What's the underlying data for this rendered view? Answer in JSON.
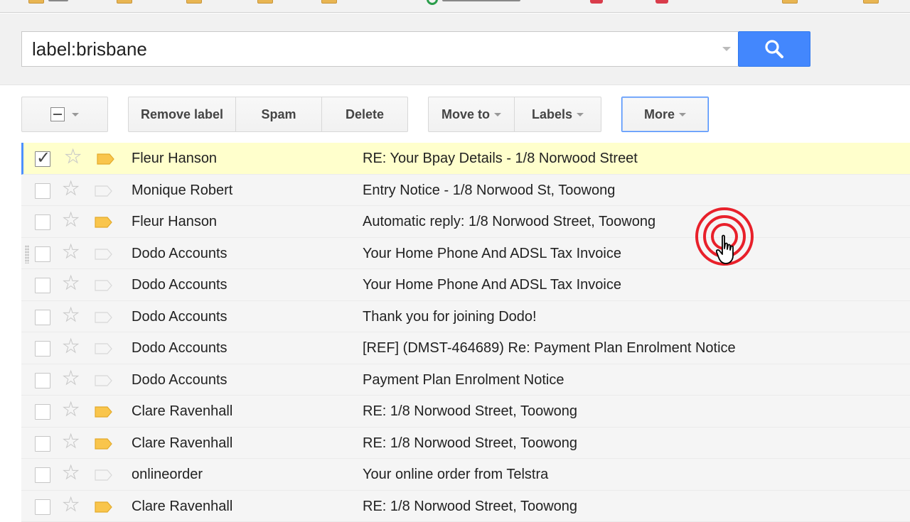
{
  "search": {
    "value": "label:brisbane",
    "button_icon": "search-icon"
  },
  "toolbar": {
    "select_icon": "select-checkbox-icon",
    "remove_label": "Remove label",
    "spam": "Spam",
    "delete": "Delete",
    "move_to": "Move to",
    "labels": "Labels",
    "more": "More"
  },
  "colors": {
    "search_button": "#4387fd",
    "selected_row": "#ffffcc",
    "label_marker": "#f9c54c",
    "ripple": "#e8202a"
  },
  "messages": [
    {
      "sender": "Fleur Hanson",
      "subject": "RE: Your Bpay Details - 1/8 Norwood Street",
      "checked": true,
      "labeled": true,
      "selected": true
    },
    {
      "sender": "Monique Robert",
      "subject": "Entry Notice - 1/8 Norwood St, Toowong",
      "checked": false,
      "labeled": false
    },
    {
      "sender": "Fleur Hanson",
      "subject": "Automatic reply: 1/8 Norwood Street, Toowong",
      "checked": false,
      "labeled": true
    },
    {
      "sender": "Dodo Accounts",
      "subject": "Your Home Phone And ADSL Tax Invoice",
      "checked": false,
      "labeled": false,
      "drag": true
    },
    {
      "sender": "Dodo Accounts",
      "subject": "Your Home Phone And ADSL Tax Invoice",
      "checked": false,
      "labeled": false
    },
    {
      "sender": "Dodo Accounts",
      "subject": "Thank you for joining Dodo!",
      "checked": false,
      "labeled": false
    },
    {
      "sender": "Dodo Accounts",
      "subject": "[REF] (DMST-464689) Re: Payment Plan Enrolment Notice",
      "checked": false,
      "labeled": false
    },
    {
      "sender": "Dodo Accounts",
      "subject": "Payment Plan Enrolment Notice",
      "checked": false,
      "labeled": false
    },
    {
      "sender": "Clare Ravenhall",
      "subject": "RE: 1/8 Norwood Street, Toowong",
      "checked": false,
      "labeled": true
    },
    {
      "sender": "Clare Ravenhall",
      "subject": "RE: 1/8 Norwood Street, Toowong",
      "checked": false,
      "labeled": true
    },
    {
      "sender": "onlineorder",
      "subject": "Your online order from Telstra",
      "checked": false,
      "labeled": false
    },
    {
      "sender": "Clare Ravenhall",
      "subject": "RE: 1/8 Norwood Street, Toowong",
      "checked": false,
      "labeled": true
    }
  ]
}
